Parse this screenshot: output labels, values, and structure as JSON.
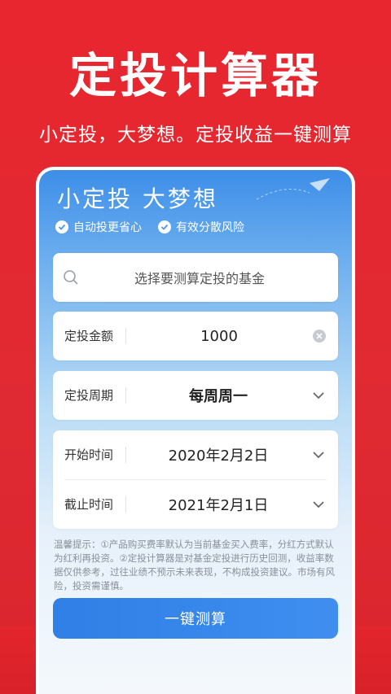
{
  "hero": {
    "title": "定投计算器",
    "subtitle": "小定投，大梦想。定投收益一键测算"
  },
  "card": {
    "title": "小定投 大梦想",
    "features": [
      "自动投更省心",
      "有效分散风险"
    ]
  },
  "search": {
    "placeholder": "选择要测算定投的基金"
  },
  "amount": {
    "label": "定投金额",
    "value": "1000"
  },
  "period": {
    "label": "定投周期",
    "value": "每周周一"
  },
  "start": {
    "label": "开始时间",
    "value": "2020年2月2日"
  },
  "end": {
    "label": "截止时间",
    "value": "2021年2月1日"
  },
  "tips": {
    "text": "温馨提示：①产品购买费率默认为当前基金买入费率，分红方式默认为红利再投资。②定投计算器是对基金定投进行历史回测，收益率数据仅供参考，过往业绩不预示未来表现，不构成投资建议。市场有风险，投资需谨慎。"
  },
  "button": {
    "label": "一键测算"
  },
  "colors": {
    "brand_red": "#e8262f",
    "accent_blue": "#2f7fe6"
  },
  "icons": [
    "search-icon",
    "check-icon",
    "clear-icon",
    "chevron-down-icon",
    "paper-plane-icon"
  ]
}
